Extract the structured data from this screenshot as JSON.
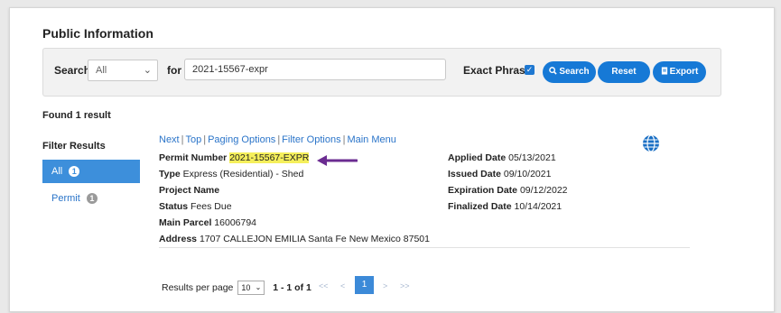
{
  "page": {
    "title": "Public Information"
  },
  "search": {
    "search_label": "Search",
    "category_selected": "All",
    "for_label": "for",
    "query_value": "2021-15567-expr",
    "exact_phrase_label": "Exact Phrase",
    "exact_phrase_checked": true,
    "search_button": "Search",
    "reset_button": "Reset",
    "export_button": "Export"
  },
  "results": {
    "found": "Found 1 result"
  },
  "filters": {
    "title": "Filter Results",
    "all_label": "All",
    "all_count": "1",
    "permit_label": "Permit",
    "permit_count": "1"
  },
  "nav": {
    "next": "Next",
    "top": "Top",
    "paging": "Paging Options",
    "filter": "Filter Options",
    "main": "Main Menu"
  },
  "record": {
    "permit_label": "Permit Number",
    "permit_value": "2021-15567-EXPR",
    "type_label": "Type",
    "type_value": "Express (Residential) - Shed",
    "project_label": "Project Name",
    "project_value": "",
    "status_label": "Status",
    "status_value": "Fees Due",
    "parcel_label": "Main Parcel",
    "parcel_value": "16006794",
    "address_label": "Address",
    "address_value": "1707 CALLEJON EMILIA Santa Fe New Mexico 87501",
    "applied_label": "Applied Date",
    "applied_value": "05/13/2021",
    "issued_label": "Issued Date",
    "issued_value": "09/10/2021",
    "expiration_label": "Expiration Date",
    "expiration_value": "09/12/2022",
    "finalized_label": "Finalized Date",
    "finalized_value": "10/14/2021"
  },
  "pager": {
    "per_page_label": "Results per page",
    "per_page_value": "10",
    "range": "1 - 1 of 1",
    "first": "<<",
    "prev": "<",
    "current": "1",
    "next": ">",
    "last": ">>"
  },
  "colors": {
    "accent": "#1679d6",
    "highlight": "#f5ef5b",
    "arrow": "#6b2c91"
  },
  "icons": [
    "search-icon",
    "export-icon",
    "globe-icon",
    "chevron-down-icon",
    "arrow-left-icon"
  ]
}
